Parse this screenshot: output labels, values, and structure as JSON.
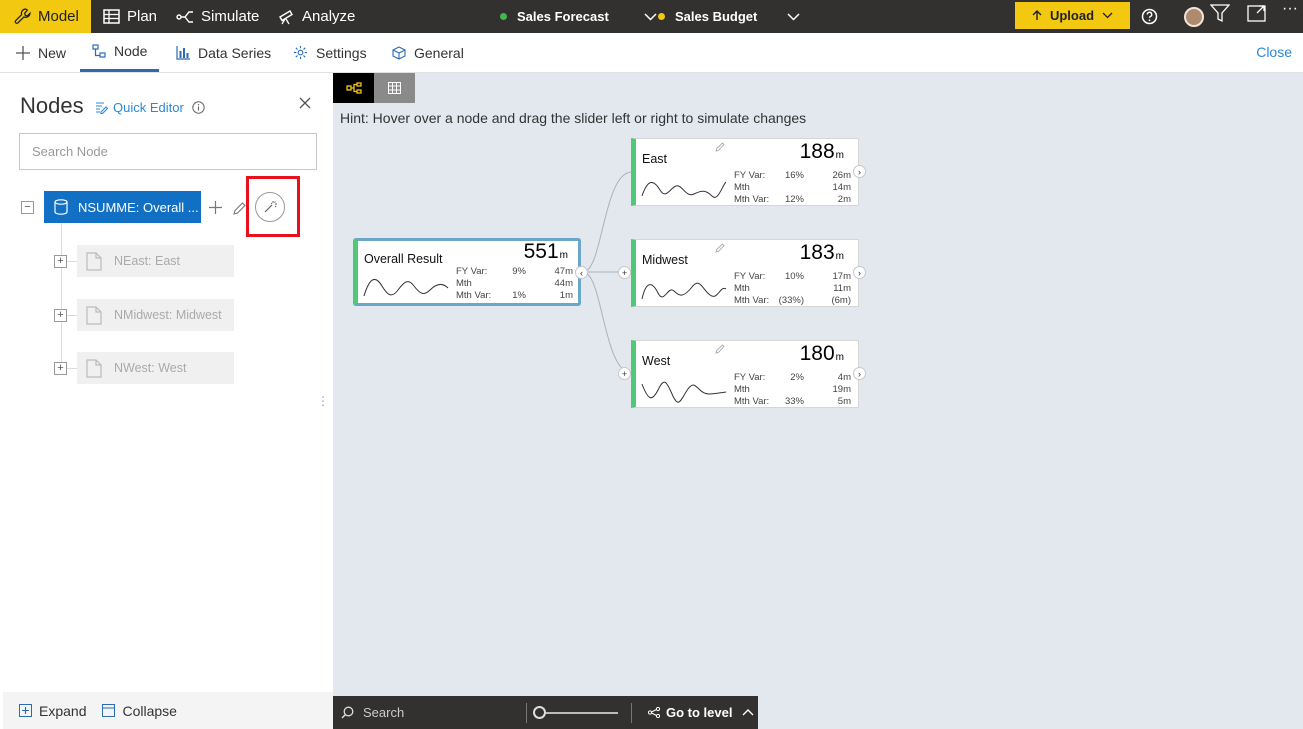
{
  "topbar": {
    "tabs": [
      {
        "label": "Model",
        "icon": "wrench-icon",
        "active": true
      },
      {
        "label": "Plan",
        "icon": "table-icon",
        "active": false
      },
      {
        "label": "Simulate",
        "icon": "branch-icon",
        "active": false
      },
      {
        "label": "Analyze",
        "icon": "telescope-icon",
        "active": false
      }
    ],
    "scenarios": [
      {
        "label": "Sales Forecast",
        "color": "#3fb950"
      },
      {
        "label": "Sales Budget",
        "color": "#f2c811"
      }
    ],
    "upload_label": "Upload"
  },
  "ribbon": {
    "items": [
      {
        "label": "New",
        "icon": "plus-icon"
      },
      {
        "label": "Node",
        "icon": "node-icon",
        "selected": true
      },
      {
        "label": "Data Series",
        "icon": "bar-chart-icon"
      },
      {
        "label": "Settings",
        "icon": "gear-icon"
      },
      {
        "label": "General",
        "icon": "cube-icon"
      }
    ],
    "close_label": "Close"
  },
  "left_panel": {
    "title": "Nodes",
    "quick_editor_label": "Quick Editor",
    "search_placeholder": "Search Node",
    "root_node": {
      "label": "NSUMME: Overall ..."
    },
    "children": [
      {
        "label": "NEast: East"
      },
      {
        "label": "NMidwest: Midwest"
      },
      {
        "label": "NWest: West"
      }
    ],
    "expand_label": "Expand",
    "collapse_label": "Collapse"
  },
  "canvas": {
    "hint": "Hint: Hover over a node and drag the slider left or right to simulate changes",
    "accent_color": "#50c878",
    "cards": {
      "root": {
        "name": "Overall Result",
        "value": "551",
        "unit": "m",
        "stats": [
          {
            "label": "FY Var:",
            "pct": "9%",
            "amt": "47m"
          },
          {
            "label": "Mth",
            "pct": "",
            "amt": "44m"
          },
          {
            "label": "Mth Var:",
            "pct": "1%",
            "amt": "1m"
          }
        ]
      },
      "east": {
        "name": "East",
        "value": "188",
        "unit": "m",
        "stats": [
          {
            "label": "FY Var:",
            "pct": "16%",
            "amt": "26m"
          },
          {
            "label": "Mth",
            "pct": "",
            "amt": "14m"
          },
          {
            "label": "Mth Var:",
            "pct": "12%",
            "amt": "2m"
          }
        ]
      },
      "midwest": {
        "name": "Midwest",
        "value": "183",
        "unit": "m",
        "stats": [
          {
            "label": "FY Var:",
            "pct": "10%",
            "amt": "17m"
          },
          {
            "label": "Mth",
            "pct": "",
            "amt": "11m"
          },
          {
            "label": "Mth Var:",
            "pct": "(33%)",
            "amt": "(6m)"
          }
        ]
      },
      "west": {
        "name": "West",
        "value": "180",
        "unit": "m",
        "stats": [
          {
            "label": "FY Var:",
            "pct": "2%",
            "amt": "4m"
          },
          {
            "label": "Mth",
            "pct": "",
            "amt": "19m"
          },
          {
            "label": "Mth Var:",
            "pct": "33%",
            "amt": "5m"
          }
        ]
      }
    },
    "bottom_bar": {
      "search_placeholder": "Search",
      "goto_label": "Go to level"
    }
  }
}
